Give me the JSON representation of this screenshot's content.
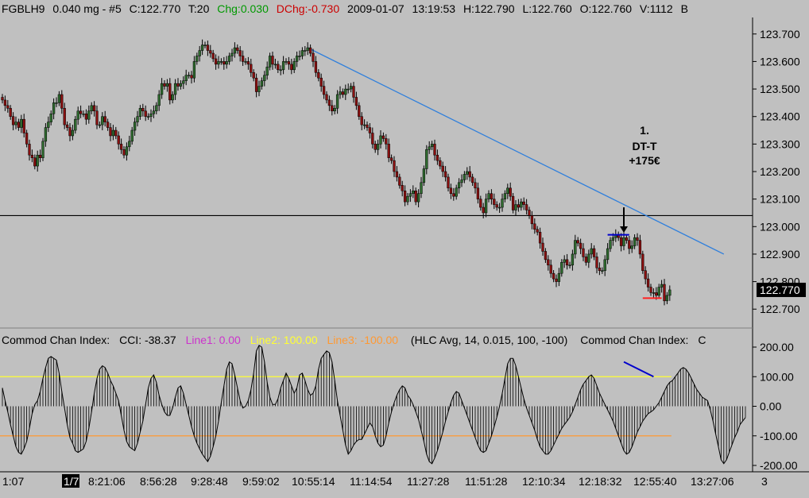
{
  "header": {
    "symbol": "FGBLH9",
    "bar_spec": "0.040 mg - #5",
    "close": "C:122.770",
    "ticks": "T:20",
    "chg": "Chg:0.030",
    "dchg": "DChg:-0.730",
    "date": "2009-01-07",
    "time": "13:19:53",
    "high": "H:122.790",
    "low": "L:122.760",
    "open": "O:122.760",
    "volume": "V:1112",
    "cut": "B"
  },
  "colors": {
    "background": "#c0c0c0",
    "bull": "#2f6b2f",
    "bear": "#8b1010",
    "trendline": "#2f7fdc",
    "level_line": "#000000",
    "cci_line1": "#cc33cc",
    "cci_line2": "#ffff33",
    "cci_line3": "#ff9933",
    "chg_text": "#009900",
    "dchg_text": "#cc0000"
  },
  "annotation": {
    "line1": "1.",
    "line2": "DT-T",
    "line3": "+175€"
  },
  "price_axis": {
    "labels": [
      "123.700",
      "123.600",
      "123.500",
      "123.400",
      "123.300",
      "123.200",
      "123.100",
      "123.000",
      "122.900",
      "122.800",
      "122.700"
    ],
    "last_price": "122.770"
  },
  "cci_legend": {
    "name": "Commod Chan Index:",
    "value": "CCI: -38.37",
    "line1": "Line1: 0.00",
    "line2": "Line2: 100.00",
    "line3": "Line3: -100.00",
    "params": "(HLC Avg, 14, 0.015, 100, -100)",
    "name2": "Commod Chan Index:",
    "cut": "C"
  },
  "cci_axis": {
    "labels": [
      "200.00",
      "100.00",
      "0.00",
      "-100.00",
      "-200.00"
    ]
  },
  "time_axis": {
    "labels": [
      "1:07",
      "1/7",
      "8:21:06",
      "8:56:28",
      "9:28:48",
      "9:59:02",
      "10:55:14",
      "11:14:54",
      "11:27:28",
      "11:51:28",
      "12:10:34",
      "12:18:32",
      "12:55:40",
      "13:27:06",
      "3"
    ]
  },
  "chart_data": [
    {
      "type": "candlestick",
      "title": "FGBLH9 0.040 mg - #5",
      "ylim": [
        122.64,
        123.76
      ],
      "horizontal_level": 123.04,
      "trendline": [
        {
          "bar": 113,
          "price": 123.65
        },
        {
          "bar": 267,
          "price": 122.9
        }
      ],
      "annotations": [
        {
          "text": "1. DT-T +175€",
          "type": "arrow_down",
          "bar": 230,
          "price": 123.07
        },
        {
          "type": "double_top_marker",
          "from_bar": 224,
          "to_bar": 232,
          "price": 122.97
        },
        {
          "type": "exit_marker",
          "from_bar": 237,
          "to_bar": 244,
          "price": 122.74
        }
      ],
      "closes": [
        123.46,
        123.44,
        123.43,
        123.4,
        123.37,
        123.38,
        123.36,
        123.39,
        123.34,
        123.3,
        123.26,
        123.25,
        123.22,
        123.26,
        123.25,
        123.31,
        123.36,
        123.38,
        123.41,
        123.45,
        123.45,
        123.48,
        123.43,
        123.37,
        123.36,
        123.33,
        123.35,
        123.39,
        123.42,
        123.41,
        123.41,
        123.39,
        123.42,
        123.44,
        123.42,
        123.37,
        123.37,
        123.4,
        123.38,
        123.36,
        123.33,
        123.35,
        123.33,
        123.3,
        123.28,
        123.26,
        123.29,
        123.31,
        123.35,
        123.38,
        123.4,
        123.43,
        123.42,
        123.4,
        123.4,
        123.41,
        123.42,
        123.44,
        123.48,
        123.52,
        123.51,
        123.52,
        123.46,
        123.48,
        123.52,
        123.51,
        123.52,
        123.53,
        123.55,
        123.55,
        123.54,
        123.6,
        123.62,
        123.64,
        123.66,
        123.66,
        123.64,
        123.63,
        123.61,
        123.59,
        123.6,
        123.6,
        123.59,
        123.6,
        123.62,
        123.63,
        123.65,
        123.64,
        123.62,
        123.6,
        123.6,
        123.59,
        123.56,
        123.54,
        123.49,
        123.51,
        123.53,
        123.55,
        123.58,
        123.62,
        123.59,
        123.59,
        123.57,
        123.57,
        123.6,
        123.6,
        123.59,
        123.57,
        123.6,
        123.62,
        123.62,
        123.64,
        123.64,
        123.65,
        123.63,
        123.6,
        123.56,
        123.54,
        123.51,
        123.48,
        123.46,
        123.44,
        123.42,
        123.43,
        123.48,
        123.49,
        123.48,
        123.5,
        123.5,
        123.51,
        123.47,
        123.44,
        123.4,
        123.37,
        123.37,
        123.36,
        123.34,
        123.3,
        123.28,
        123.3,
        123.33,
        123.32,
        123.3,
        123.25,
        123.24,
        123.2,
        123.18,
        123.15,
        123.13,
        123.09,
        123.11,
        123.12,
        123.13,
        123.09,
        123.12,
        123.16,
        123.21,
        123.28,
        123.29,
        123.3,
        123.26,
        123.24,
        123.22,
        123.2,
        123.18,
        123.14,
        123.12,
        123.11,
        123.14,
        123.16,
        123.17,
        123.19,
        123.2,
        123.18,
        123.16,
        123.14,
        123.1,
        123.07,
        123.05,
        123.1,
        123.12,
        123.1,
        123.08,
        123.07,
        123.07,
        123.1,
        123.12,
        123.14,
        123.11,
        123.06,
        123.08,
        123.07,
        123.09,
        123.08,
        123.06,
        123.04,
        123.01,
        122.99,
        122.98,
        122.94,
        122.91,
        122.88,
        122.86,
        122.83,
        122.81,
        122.8,
        122.83,
        122.87,
        122.88,
        122.86,
        122.86,
        122.9,
        122.95,
        122.94,
        122.92,
        122.89,
        122.87,
        122.9,
        122.92,
        122.89,
        122.85,
        122.84,
        122.84,
        122.88,
        122.92,
        122.95,
        122.96,
        122.97,
        122.96,
        122.93,
        122.96,
        122.95,
        122.92,
        122.93,
        122.96,
        122.95,
        122.9,
        122.84,
        122.81,
        122.78,
        122.76,
        122.76,
        122.75,
        122.78,
        122.79,
        122.73,
        122.75,
        122.77
      ]
    },
    {
      "type": "bar",
      "title": "Commod Chan Index",
      "ylim": [
        -200,
        200
      ],
      "reference_lines": [
        100,
        0,
        -100
      ],
      "values": [
        62,
        19,
        -19,
        -62,
        -100,
        -137,
        -156,
        -162,
        -144,
        -119,
        -75,
        -25,
        6,
        19,
        50,
        94,
        131,
        162,
        168,
        162,
        156,
        112,
        50,
        -6,
        -62,
        -106,
        -125,
        -150,
        -156,
        -150,
        -144,
        -119,
        -75,
        -19,
        44,
        94,
        125,
        137,
        131,
        112,
        87,
        69,
        44,
        19,
        -31,
        -81,
        -119,
        -137,
        -144,
        -150,
        -125,
        -87,
        -50,
        6,
        62,
        94,
        106,
        81,
        37,
        6,
        -19,
        -31,
        -31,
        -6,
        31,
        62,
        69,
        44,
        6,
        -31,
        -69,
        -100,
        -125,
        -144,
        -162,
        -175,
        -187,
        -169,
        -137,
        -100,
        -50,
        12,
        69,
        125,
        150,
        144,
        106,
        62,
        19,
        -6,
        0,
        19,
        56,
        112,
        187,
        206,
        200,
        150,
        81,
        31,
        6,
        6,
        25,
        62,
        87,
        112,
        94,
        69,
        44,
        62,
        106,
        112,
        87,
        56,
        37,
        44,
        69,
        125,
        162,
        175,
        187,
        181,
        150,
        87,
        19,
        -31,
        -81,
        -131,
        -162,
        -150,
        -131,
        -119,
        -112,
        -112,
        -94,
        -75,
        -56,
        -69,
        -100,
        -125,
        -137,
        -131,
        -100,
        -56,
        -19,
        12,
        37,
        56,
        69,
        62,
        37,
        25,
        6,
        -19,
        -44,
        -81,
        -119,
        -162,
        -187,
        -194,
        -175,
        -150,
        -119,
        -87,
        -50,
        -19,
        12,
        37,
        50,
        44,
        19,
        -6,
        -31,
        -56,
        -81,
        -106,
        -131,
        -150,
        -156,
        -150,
        -125,
        -100,
        -69,
        -37,
        0,
        44,
        94,
        144,
        162,
        162,
        137,
        100,
        62,
        25,
        -6,
        -31,
        -56,
        -81,
        -112,
        -137,
        -150,
        -162,
        -162,
        -150,
        -131,
        -112,
        -94,
        -75,
        -62,
        -50,
        -37,
        -19,
        6,
        31,
        56,
        75,
        87,
        100,
        106,
        94,
        69,
        44,
        25,
        6,
        -12,
        -31,
        -50,
        -75,
        -100,
        -125,
        -150,
        -162,
        -156,
        -137,
        -112,
        -87,
        -69,
        -50,
        -37,
        -25,
        -19,
        -12,
        0,
        12,
        31,
        50,
        69,
        81,
        87,
        100,
        112,
        125,
        131,
        125,
        112,
        94,
        75,
        56,
        44,
        31,
        25,
        19,
        -12,
        -50,
        -94,
        -137,
        -181,
        -194,
        -181,
        -156,
        -131,
        -106,
        -87,
        -62,
        -50,
        -38
      ]
    }
  ]
}
